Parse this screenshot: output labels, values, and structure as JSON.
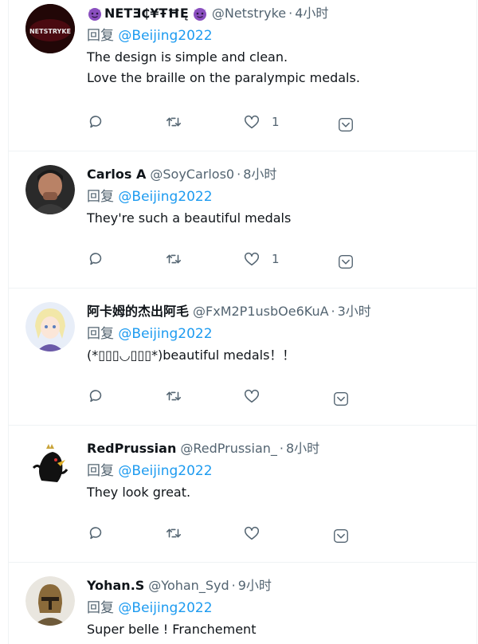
{
  "tweets": [
    {
      "name": "NETƎ₵¥ŦĦĘ",
      "handle": "@Netstryke",
      "time": "4小时",
      "reply_prefix": "回复",
      "reply_to": "@Beijing2022",
      "lines": [
        "The design is simple and clean.",
        "Love the braille on the paralympic medals."
      ],
      "like_count": "1",
      "avatar_text": "NETSTRYKE"
    },
    {
      "name": "Carlos A",
      "handle": "@SoyCarlos0",
      "time": "8小时",
      "reply_prefix": "回复",
      "reply_to": "@Beijing2022",
      "lines": [
        "They're such a beautiful medals"
      ],
      "like_count": "1"
    },
    {
      "name": "阿卡姆的杰出阿毛",
      "handle": "@FxM2P1usbOe6KuA",
      "time": "3小时",
      "reply_prefix": "回复",
      "reply_to": "@Beijing2022",
      "lines": [
        "(*▯▯▯◡▯▯▯*)beautiful medals！！"
      ],
      "like_count": ""
    },
    {
      "name": "RedPrussian",
      "handle": "@RedPrussian_",
      "time": "8小时",
      "reply_prefix": "回复",
      "reply_to": "@Beijing2022",
      "lines": [
        "They look great."
      ],
      "like_count": ""
    },
    {
      "name": "Yohan.S",
      "handle": "@Yohan_Syd",
      "time": "9小时",
      "reply_prefix": "回复",
      "reply_to": "@Beijing2022",
      "lines": [
        "Super belle ! Franchement"
      ],
      "like_count": ""
    }
  ],
  "dot": "·",
  "colors": {
    "mention": "#1d9bf0",
    "secondary": "#536471",
    "border": "#eff3f4"
  },
  "icons": [
    "reply-icon",
    "retweet-icon",
    "like-icon",
    "share-icon",
    "devil-emoji-icon"
  ]
}
